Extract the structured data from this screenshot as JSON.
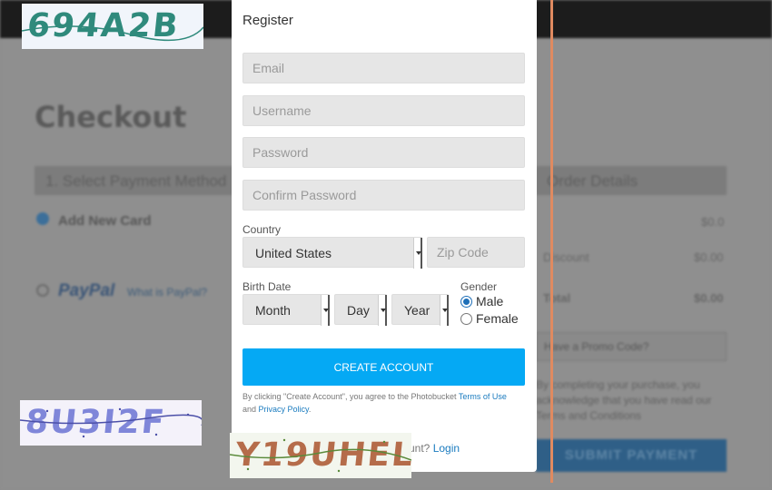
{
  "background_page": {
    "title": "Checkout",
    "step_label": "1. Select Payment Method",
    "order_details_label": "Order Details",
    "add_new_card": "Add New Card",
    "paypal": "PayPal",
    "what_is_paypal": "What is PayPal?",
    "order_rows": [
      {
        "label": "",
        "value": "$0.0"
      },
      {
        "label": "Discount",
        "value": "$0.00"
      },
      {
        "label": "Total",
        "value": "$0.00"
      }
    ],
    "promo": "Have a Promo Code?",
    "agreement": "By completing your purchase, you acknowledge that you have read our Terms and Conditions",
    "submit_payment": "SUBMIT PAYMENT"
  },
  "modal": {
    "title": "Register",
    "email_placeholder": "Email",
    "username_placeholder": "Username",
    "password_placeholder": "Password",
    "confirm_password_placeholder": "Confirm Password",
    "country_label": "Country",
    "country_value": "United States",
    "zip_placeholder": "Zip Code",
    "birth_date_label": "Birth Date",
    "month": "Month",
    "day": "Day",
    "year": "Year",
    "gender_label": "Gender",
    "male": "Male",
    "female": "Female",
    "gender_selected": "Male",
    "create_account": "CREATE ACCOUNT",
    "terms_prefix": "By clicking \"Create Account\", you agree to the Photobucket",
    "terms_link": "Terms of Use",
    "terms_and": "and",
    "privacy_link": "Privacy Policy",
    "terms_suffix": ".",
    "have_account_text": "unt?",
    "login_link": "Login"
  },
  "captchas": [
    {
      "text": "694A2B",
      "color": "#2f8a7c"
    },
    {
      "text": "8U3I2F",
      "color": "#7f86d9"
    },
    {
      "text": "Y19UHEL",
      "color": "#b56c4a"
    }
  ],
  "colors": {
    "accent": "#05a9f4",
    "link": "#1a7bbf",
    "divider_line": "#e08a60"
  }
}
